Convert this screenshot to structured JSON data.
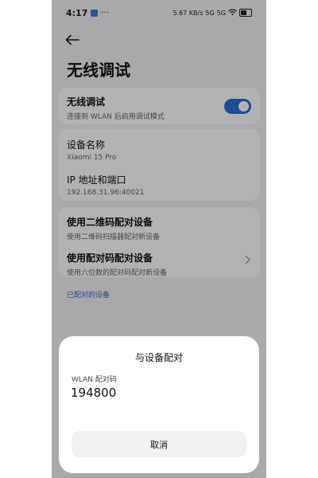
{
  "status_bar": {
    "time": "4:17",
    "more": "···",
    "speed": "5.67 KB/s",
    "signal1": "5G",
    "signal2": "5G"
  },
  "page": {
    "title": "无线调试"
  },
  "wireless_debugging": {
    "title": "无线调试",
    "subtitle": "连接到 WLAN 后启用调试模式",
    "enabled": true
  },
  "device_info": {
    "name_title": "设备名称",
    "name_value": "Xiaomi 15 Pro",
    "ip_title": "IP 地址和端口",
    "ip_value": "192.168.31.96:40021"
  },
  "pairing": {
    "qr_title": "使用二维码配对设备",
    "qr_subtitle": "使用二维码扫描器配对新设备",
    "code_title": "使用配对码配对设备",
    "code_subtitle": "使用六位数的配对码配对新设备"
  },
  "paired_devices_label": "已配对的设备",
  "dialog": {
    "title": "与设备配对",
    "code_label": "WLAN 配对码",
    "code_value": "194800",
    "cancel_label": "取消"
  }
}
